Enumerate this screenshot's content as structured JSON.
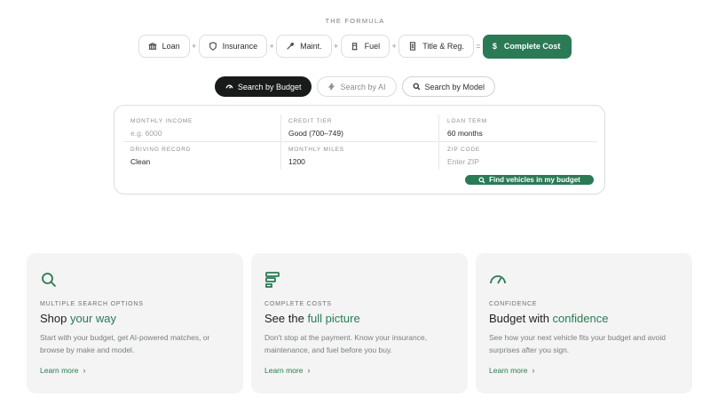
{
  "formula": {
    "title": "THE FORMULA",
    "items": [
      {
        "label": "Loan",
        "icon": "bank-icon"
      },
      {
        "label": "Insurance",
        "icon": "shield-icon"
      },
      {
        "label": "Maint.",
        "icon": "wrench-icon"
      },
      {
        "label": "Fuel",
        "icon": "fuel-icon"
      },
      {
        "label": "Title & Reg.",
        "icon": "document-icon"
      }
    ],
    "plus": "+",
    "equals": "=",
    "total_symbol": "$",
    "total_label": "Complete Cost"
  },
  "tabs": [
    {
      "label": "Search by Budget",
      "icon": "speedometer-icon",
      "active": true
    },
    {
      "label": "Search by AI",
      "icon": "bolt-icon",
      "active": false
    },
    {
      "label": "Search by Model",
      "icon": "search-icon",
      "active": false
    }
  ],
  "form": {
    "monthly_income": {
      "label": "MONTHLY INCOME",
      "placeholder": "e.g. 6000"
    },
    "credit_tier": {
      "label": "CREDIT TIER",
      "value": "Good (700–749)"
    },
    "loan_term": {
      "label": "LOAN TERM",
      "value": "60 months"
    },
    "driving_record": {
      "label": "DRIVING RECORD",
      "value": "Clean"
    },
    "monthly_miles": {
      "label": "MONTHLY MILES",
      "value": "1200"
    },
    "zip_code": {
      "label": "ZIP CODE",
      "placeholder": "Enter ZIP"
    },
    "submit_label": "Find vehicles in my budget"
  },
  "features": [
    {
      "icon": "search-icon",
      "eyebrow": "MULTIPLE SEARCH OPTIONS",
      "title_prefix": "Shop ",
      "title_accent": "your way",
      "description": "Start with your budget, get AI-powered matches, or browse by make and model.",
      "link": "Learn more"
    },
    {
      "icon": "layers-icon",
      "eyebrow": "COMPLETE COSTS",
      "title_prefix": "See the ",
      "title_accent": "full picture",
      "description": "Don't stop at the payment. Know your insurance, maintenance, and fuel before you buy.",
      "link": "Learn more"
    },
    {
      "icon": "gauge-icon",
      "eyebrow": "CONFIDENCE",
      "title_prefix": "Budget with ",
      "title_accent": "confidence",
      "description": "See how your next vehicle fits your budget and avoid surprises after you sign.",
      "link": "Learn more"
    }
  ],
  "colors": {
    "accent": "#2a7a55",
    "dark": "#191b1a",
    "card_bg": "#f3f4f3"
  }
}
